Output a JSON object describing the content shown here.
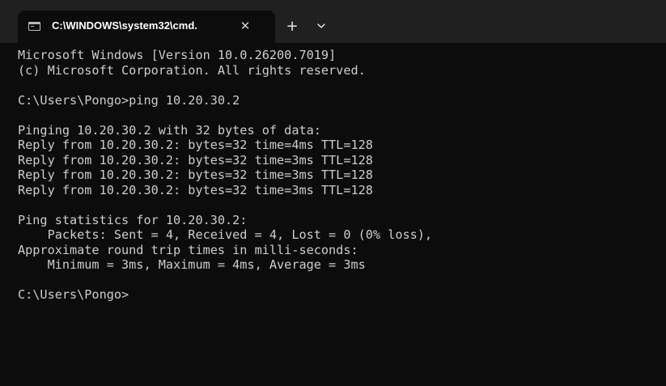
{
  "window": {
    "tab_title": "C:\\WINDOWS\\system32\\cmd.",
    "tab_icon": "terminal-icon",
    "close_icon": "close-icon",
    "new_tab_icon": "plus-icon",
    "dropdown_icon": "chevron-down-icon"
  },
  "colors": {
    "background": "#0c0c0c",
    "tab_bar": "#202020",
    "text": "#cccccc"
  },
  "console": {
    "lines": [
      "Microsoft Windows [Version 10.0.26200.7019]",
      "(c) Microsoft Corporation. All rights reserved.",
      "",
      "C:\\Users\\Pongo>ping 10.20.30.2",
      "",
      "Pinging 10.20.30.2 with 32 bytes of data:",
      "Reply from 10.20.30.2: bytes=32 time=4ms TTL=128",
      "Reply from 10.20.30.2: bytes=32 time=3ms TTL=128",
      "Reply from 10.20.30.2: bytes=32 time=3ms TTL=128",
      "Reply from 10.20.30.2: bytes=32 time=3ms TTL=128",
      "",
      "Ping statistics for 10.20.30.2:",
      "    Packets: Sent = 4, Received = 4, Lost = 0 (0% loss),",
      "Approximate round trip times in milli-seconds:",
      "    Minimum = 3ms, Maximum = 4ms, Average = 3ms",
      "",
      "C:\\Users\\Pongo>"
    ]
  }
}
